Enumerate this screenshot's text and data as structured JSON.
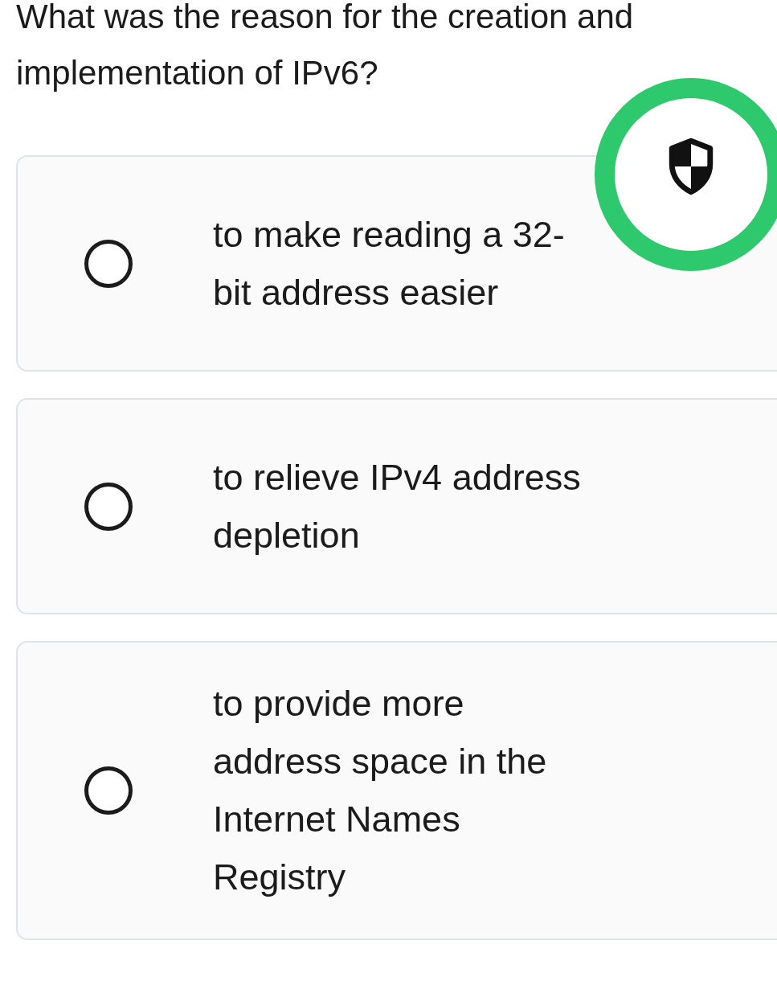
{
  "question": "What was the reason for the creation and implementation of IPv6?",
  "options": [
    {
      "text": "to make reading a 32-bit address easier",
      "selected": false
    },
    {
      "text": "to relieve IPv4 address depletion",
      "selected": false
    },
    {
      "text": "to provide more address space in the Internet Names Registry",
      "selected": false
    }
  ]
}
